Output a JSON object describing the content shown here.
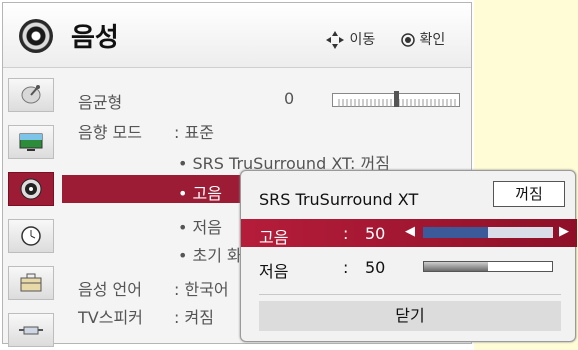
{
  "header": {
    "title": "음성",
    "move_hint": "이동",
    "confirm_hint": "확인",
    "move_icon": "four-way-arrows-icon",
    "confirm_icon": "ok-circle-icon"
  },
  "sidebar": {
    "items": [
      {
        "icon": "satellite-dish-icon"
      },
      {
        "icon": "screen-picture-icon"
      },
      {
        "icon": "speaker-sound-icon"
      },
      {
        "icon": "clock-icon"
      },
      {
        "icon": "toolbox-icon"
      },
      {
        "icon": "connector-input-icon"
      }
    ]
  },
  "menu": {
    "equalizer": {
      "label": "음균형",
      "value": "0"
    },
    "sound_mode": {
      "label": "음향 모드",
      "value": ": 표준"
    },
    "srs_sub": "• SRS TruSurround XT: 꺼짐",
    "treble_sub": "• 고음",
    "bass_sub": "• 저음",
    "reset_sub": "• 초기 화",
    "language": {
      "label": "음성 언어",
      "value": ": 한국어"
    },
    "tv_speaker": {
      "label": "TV스피커",
      "value": ": 켜짐"
    }
  },
  "balance": {
    "level": 0,
    "range": [
      -50,
      50
    ]
  },
  "popup": {
    "srs": {
      "label": "SRS TruSurround XT",
      "value": "꺼짐"
    },
    "treble": {
      "label": "고음",
      "colon": ":",
      "value": "50",
      "level_fraction": 0.5
    },
    "bass": {
      "label": "저음",
      "colon": ":",
      "value": "50",
      "level_fraction": 0.5
    },
    "close_label": "닫기"
  },
  "colors": {
    "accent": "#9b1c34",
    "highlight": "#b51d3a",
    "slider_blue": "#3b5a9a"
  }
}
